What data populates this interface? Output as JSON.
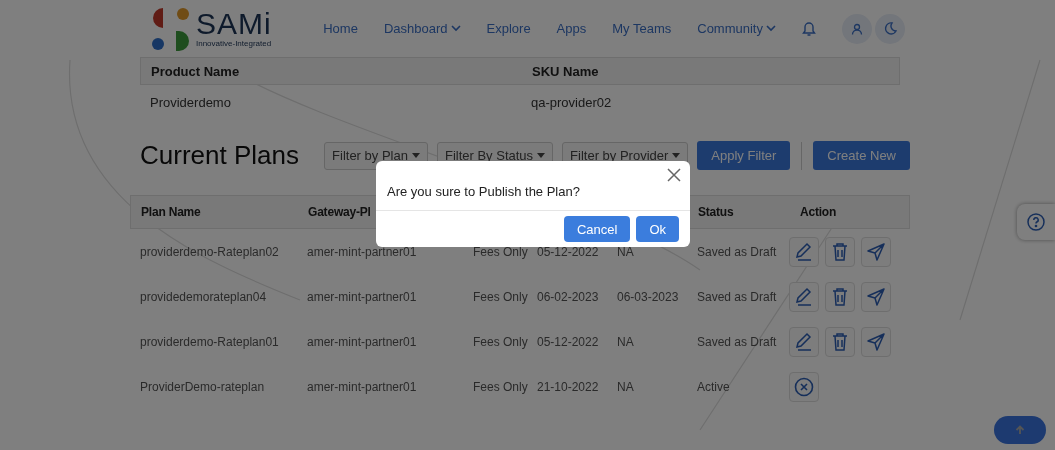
{
  "header": {
    "brand": {
      "name": "SAMi",
      "tagline": "Innovative-Integrated"
    },
    "nav": [
      {
        "label": "Home",
        "dropdown": false
      },
      {
        "label": "Dashboard",
        "dropdown": true
      },
      {
        "label": "Explore",
        "dropdown": false
      },
      {
        "label": "Apps",
        "dropdown": false
      },
      {
        "label": "My Teams",
        "dropdown": false
      },
      {
        "label": "Community",
        "dropdown": true
      }
    ]
  },
  "product_table": {
    "columns": [
      "Product Name",
      "SKU Name"
    ],
    "rows": [
      [
        "Providerdemo",
        "qa-provider02"
      ]
    ]
  },
  "plans": {
    "title": "Current Plans",
    "filters": [
      "Filter by Plan",
      "Filter By Status",
      "Filter by Provider"
    ],
    "buttons": [
      "Apply Filter",
      "Create New"
    ],
    "columns": [
      "Plan Name",
      "Gateway-Pl",
      null,
      null,
      null,
      "Status",
      "Action"
    ],
    "rows": [
      {
        "cells": [
          "providerdemo-Rateplan02",
          "amer-mint-partner01",
          "Fees Only",
          "05-12-2022",
          "NA",
          "Saved as Draft"
        ],
        "actions": [
          {
            "kind": "edit"
          },
          {
            "kind": "delete"
          },
          {
            "kind": "publish"
          }
        ]
      },
      {
        "cells": [
          "providedemorateplan04",
          "amer-mint-partner01",
          "Fees Only",
          "06-02-2023",
          "06-03-2023",
          "Saved as Draft"
        ],
        "actions": [
          {
            "kind": "edit"
          },
          {
            "kind": "delete"
          },
          {
            "kind": "publish"
          }
        ]
      },
      {
        "cells": [
          "providerdemo-Rateplan01",
          "amer-mint-partner01",
          "Fees Only",
          "05-12-2022",
          "NA",
          "Saved as Draft"
        ],
        "actions": [
          {
            "kind": "edit"
          },
          {
            "kind": "delete"
          },
          {
            "kind": "publish"
          }
        ]
      },
      {
        "cells": [
          "ProviderDemo-rateplan",
          "amer-mint-partner01",
          "Fees Only",
          "21-10-2022",
          "NA",
          "Active"
        ],
        "actions": [
          {
            "kind": "cancel"
          }
        ]
      }
    ]
  },
  "dialog": {
    "message": "Are you sure to Publish the Plan?",
    "buttons": [
      "Cancel",
      "Ok"
    ]
  }
}
